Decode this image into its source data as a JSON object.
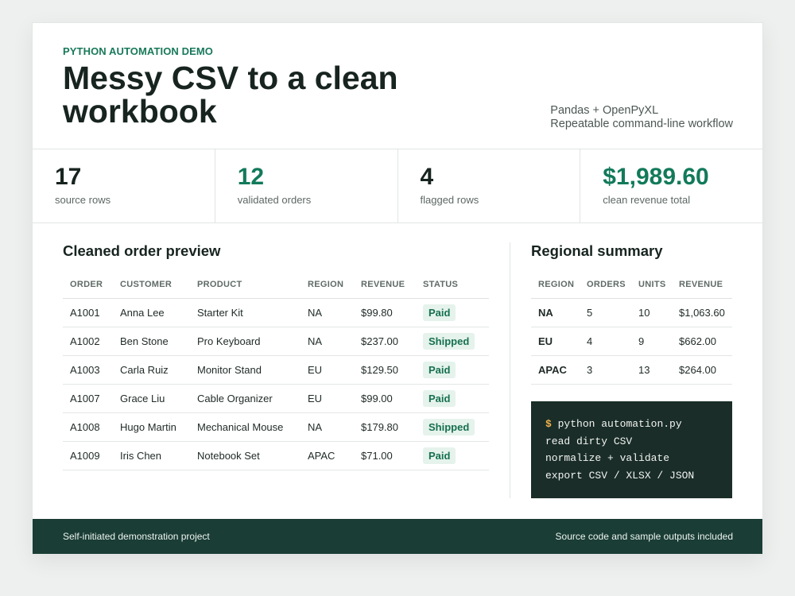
{
  "header": {
    "eyebrow": "PYTHON AUTOMATION DEMO",
    "title": "Messy CSV to a clean workbook",
    "meta_line1": "Pandas + OpenPyXL",
    "meta_line2": "Repeatable command-line workflow"
  },
  "stats": [
    {
      "value": "17",
      "label": "source rows"
    },
    {
      "value": "12",
      "label": "validated orders"
    },
    {
      "value": "4",
      "label": "flagged rows"
    },
    {
      "value": "$1,989.60",
      "label": "clean revenue total"
    }
  ],
  "colors": {
    "accent": "#127a5a",
    "badge_bg": "#e5f3ec",
    "footer_bg": "#1a3d35",
    "terminal_bg": "#1a2d28",
    "prompt": "#f2b34a"
  },
  "orders": {
    "title": "Cleaned order preview",
    "columns": [
      "ORDER",
      "CUSTOMER",
      "PRODUCT",
      "REGION",
      "REVENUE",
      "STATUS"
    ],
    "rows": [
      {
        "order": "A1001",
        "customer": "Anna Lee",
        "product": "Starter Kit",
        "region": "NA",
        "revenue": "$99.80",
        "status": "Paid"
      },
      {
        "order": "A1002",
        "customer": "Ben Stone",
        "product": "Pro Keyboard",
        "region": "NA",
        "revenue": "$237.00",
        "status": "Shipped"
      },
      {
        "order": "A1003",
        "customer": "Carla Ruiz",
        "product": "Monitor Stand",
        "region": "EU",
        "revenue": "$129.50",
        "status": "Paid"
      },
      {
        "order": "A1007",
        "customer": "Grace Liu",
        "product": "Cable Organizer",
        "region": "EU",
        "revenue": "$99.00",
        "status": "Paid"
      },
      {
        "order": "A1008",
        "customer": "Hugo Martin",
        "product": "Mechanical Mouse",
        "region": "NA",
        "revenue": "$179.80",
        "status": "Shipped"
      },
      {
        "order": "A1009",
        "customer": "Iris Chen",
        "product": "Notebook Set",
        "region": "APAC",
        "revenue": "$71.00",
        "status": "Paid"
      }
    ]
  },
  "summary": {
    "title": "Regional summary",
    "columns": [
      "REGION",
      "ORDERS",
      "UNITS",
      "REVENUE"
    ],
    "rows": [
      {
        "region": "NA",
        "orders": "5",
        "units": "10",
        "revenue": "$1,063.60"
      },
      {
        "region": "EU",
        "orders": "4",
        "units": "9",
        "revenue": "$662.00"
      },
      {
        "region": "APAC",
        "orders": "3",
        "units": "13",
        "revenue": "$264.00"
      }
    ]
  },
  "terminal": {
    "prompt": "$",
    "command": "python automation.py",
    "lines": [
      "read dirty CSV",
      "normalize + validate",
      "export CSV / XLSX / JSON"
    ]
  },
  "footer": {
    "left": "Self-initiated demonstration project",
    "right": "Source code and sample outputs included"
  }
}
